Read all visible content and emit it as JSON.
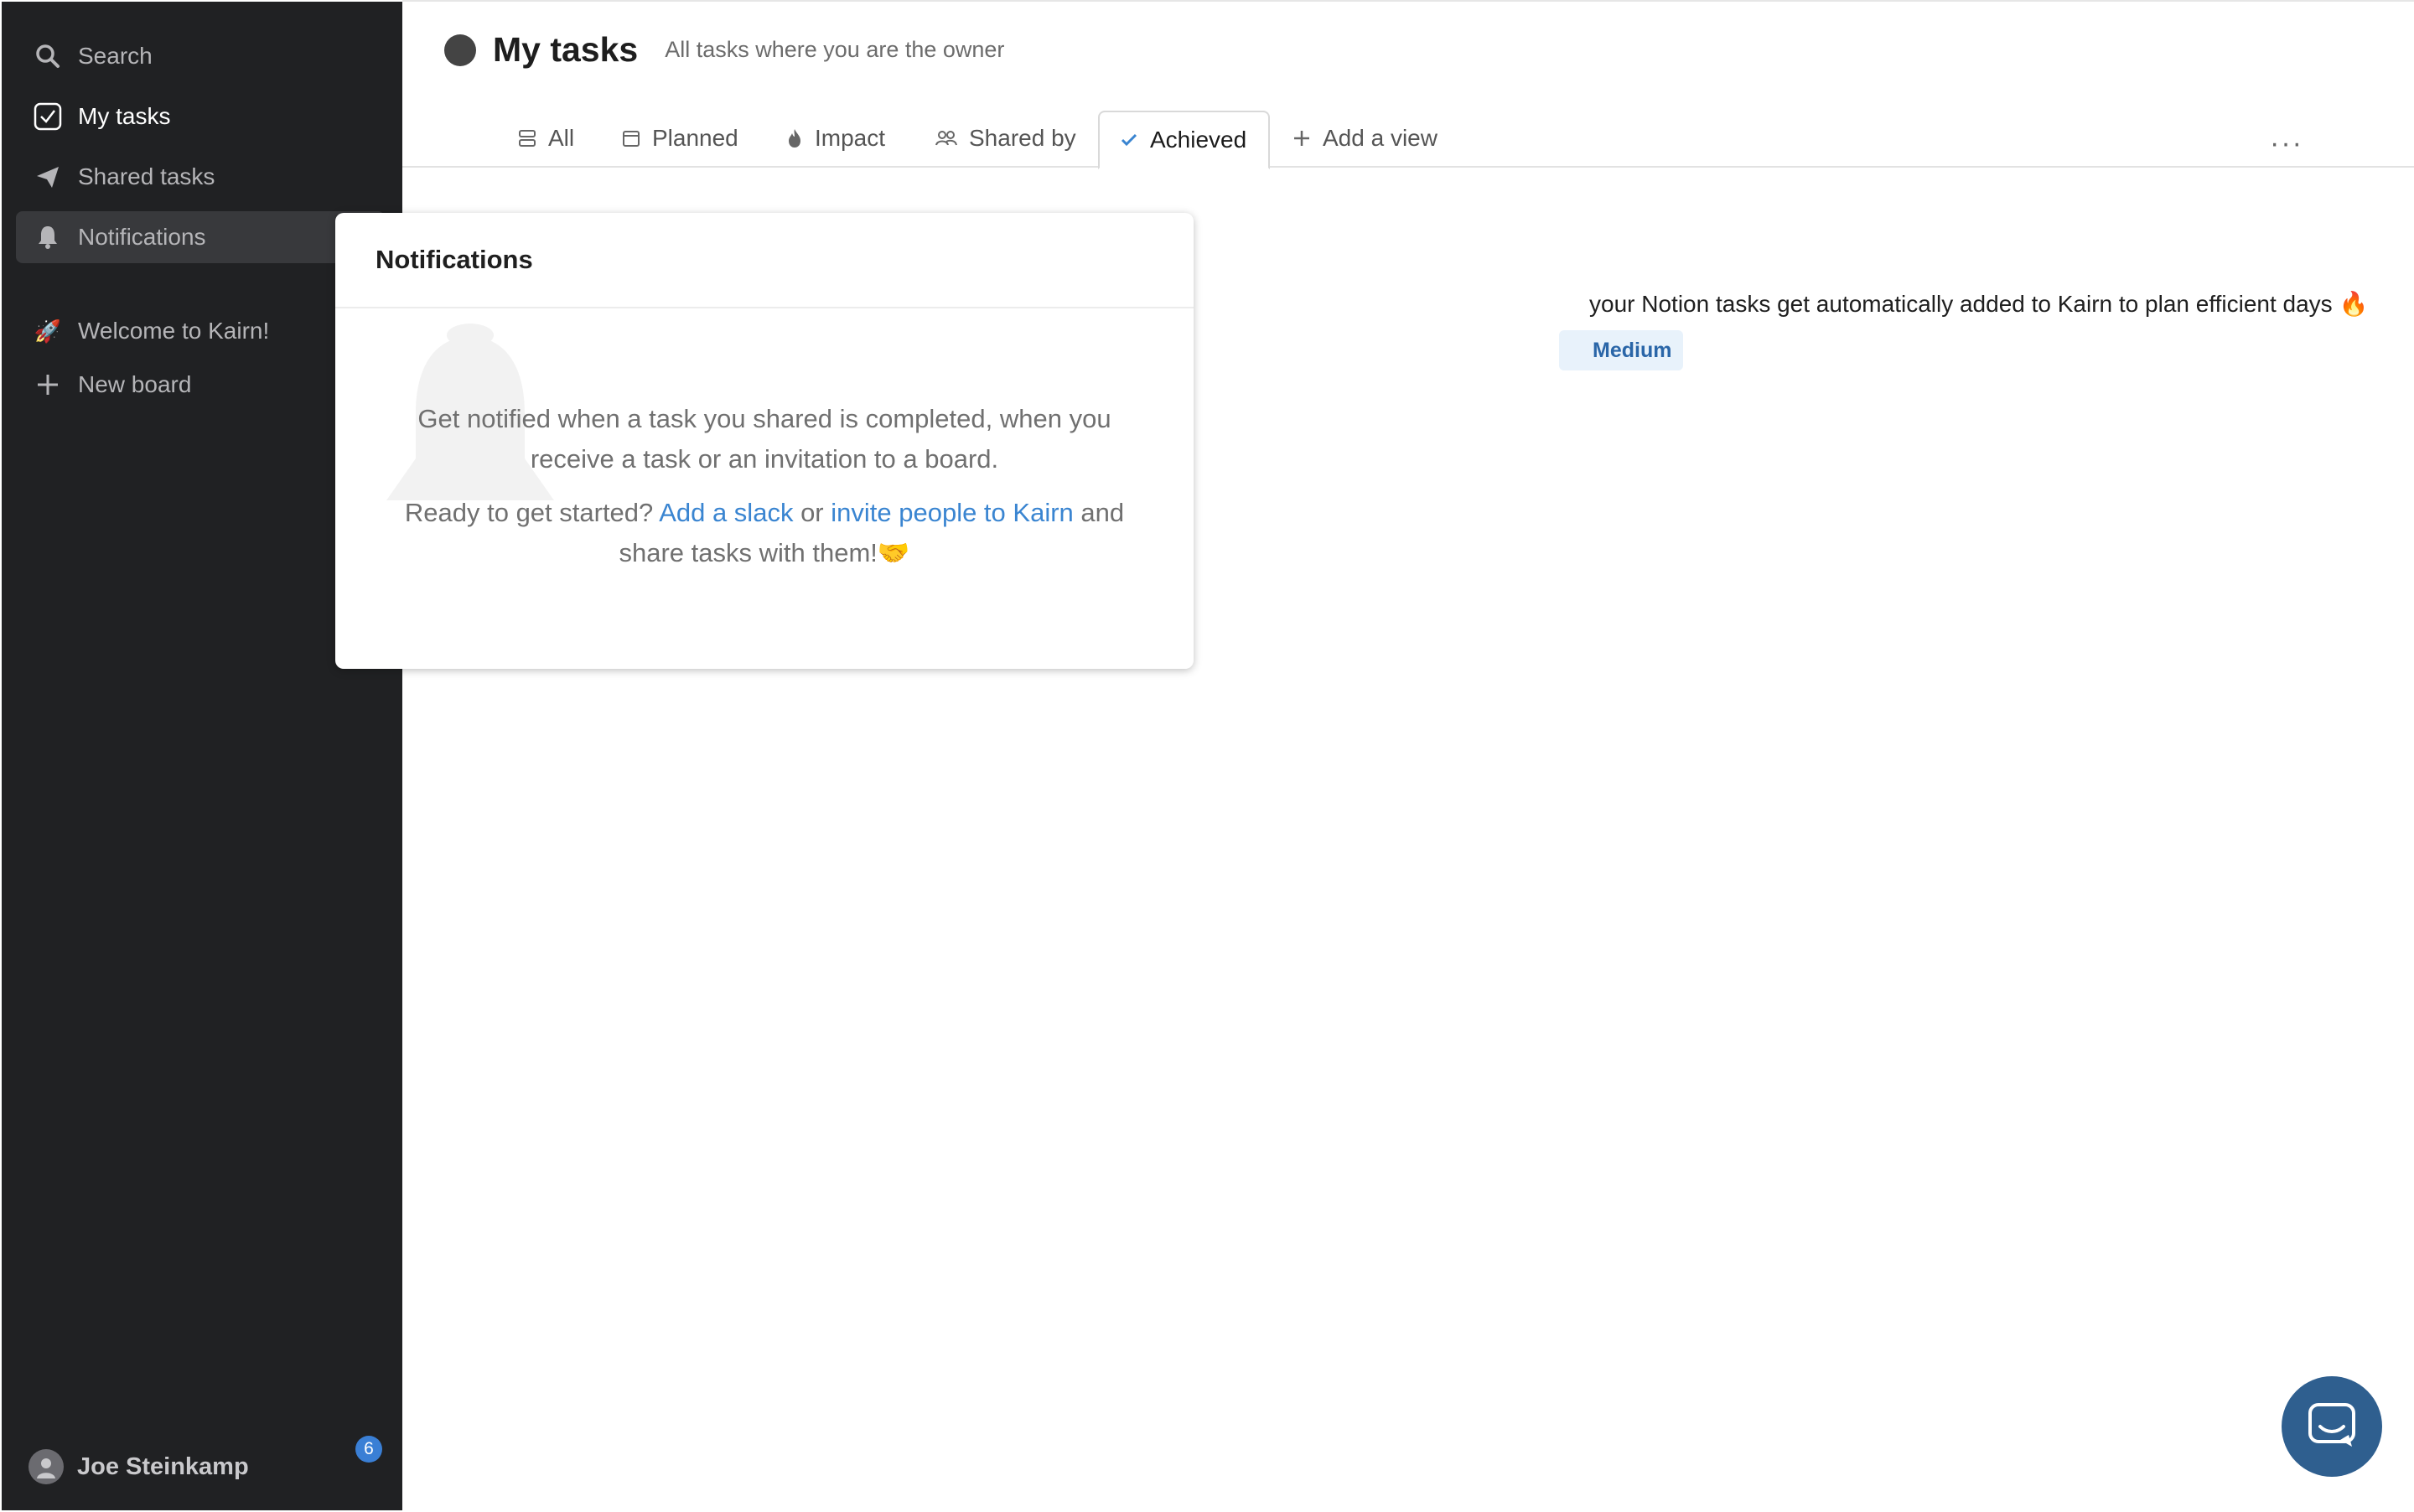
{
  "sidebar": {
    "search_label": "Search",
    "my_tasks_label": "My tasks",
    "shared_tasks_label": "Shared tasks",
    "notifications_label": "Notifications",
    "welcome_label": "Welcome to Kairn!",
    "new_board_label": "New board",
    "user_name": "Joe Steinkamp",
    "notification_count": "6"
  },
  "header": {
    "title": "My tasks",
    "subtitle": "All tasks where you are the owner"
  },
  "tabs": {
    "all": "All",
    "planned": "Planned",
    "impact": "Impact",
    "shared_by": "Shared by",
    "achieved": "Achieved",
    "add_view": "Add a view",
    "more": "···"
  },
  "task": {
    "text": "your Notion tasks get automatically added to Kairn to plan efficient days 🔥",
    "priority": "Medium"
  },
  "popup": {
    "title": "Notifications",
    "line1": "Get notified when a task you shared is completed, when you receive a task or an invitation to a board.",
    "cta_prefix": "Ready to get started? ",
    "link_slack": "Add a slack",
    "cta_or": " or ",
    "link_invite": "invite people to Kairn",
    "cta_suffix": " and share tasks with them!🤝"
  },
  "colors": {
    "sidebar_bg": "#202123",
    "accent": "#3a85d1",
    "chat_button": "#2f5f8f"
  }
}
